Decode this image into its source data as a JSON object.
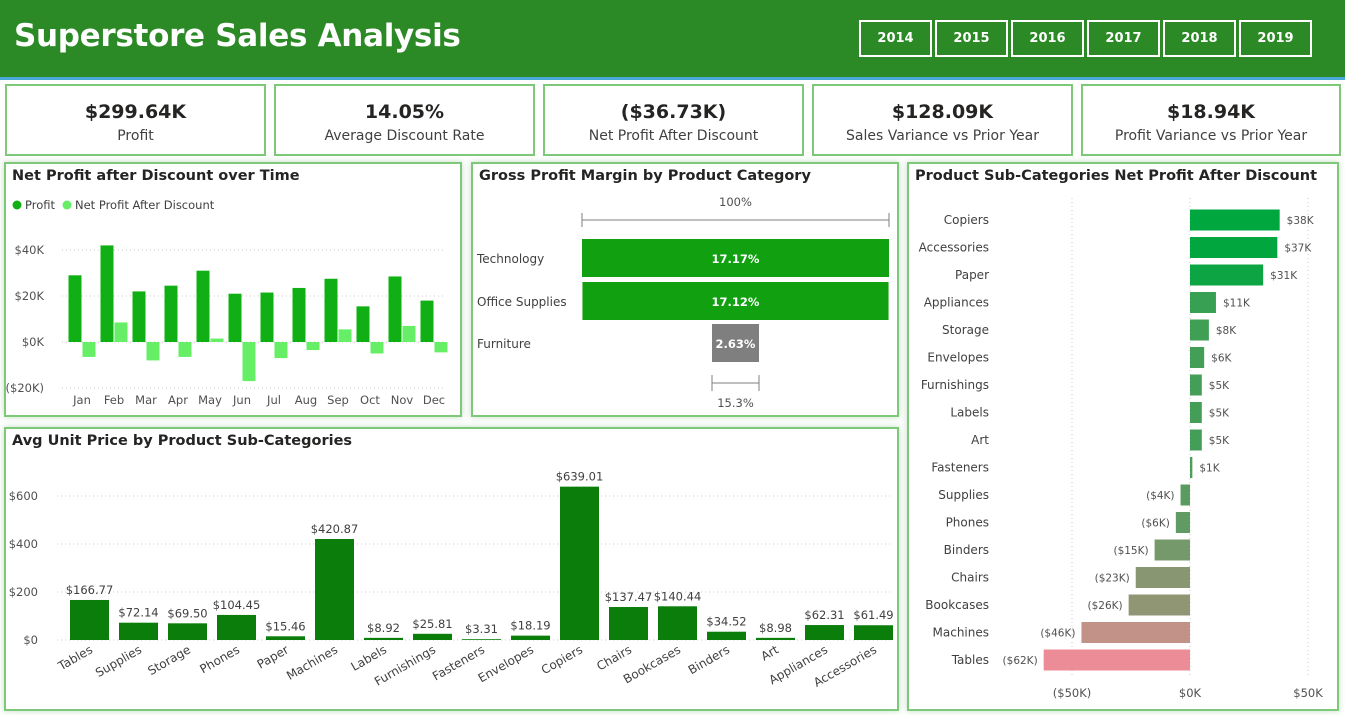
{
  "header": {
    "title": "Superstore Sales Analysis",
    "years": [
      "2014",
      "2015",
      "2016",
      "2017",
      "2018",
      "2019"
    ]
  },
  "kpis": [
    {
      "value": "$299.64K",
      "label": "Profit"
    },
    {
      "value": "14.05%",
      "label": "Average Discount Rate"
    },
    {
      "value": "($36.73K)",
      "label": "Net Profit After Discount"
    },
    {
      "value": "$128.09K",
      "label": "Sales Variance vs Prior Year"
    },
    {
      "value": "$18.94K",
      "label": "Profit Variance vs Prior Year"
    }
  ],
  "colors": {
    "header_green": "#2b8a26",
    "profit": "#10b014",
    "net_profit_after_discount": "#66ee66",
    "funnel_bar": "#10a010",
    "funnel_grey": "#7f7f7f",
    "unit_price_bar": "#0a7d0a"
  },
  "chart_data": [
    {
      "type": "bar",
      "title": "Net Profit after Discount over Time",
      "categories": [
        "Jan",
        "Feb",
        "Mar",
        "Apr",
        "May",
        "Jun",
        "Jul",
        "Aug",
        "Sep",
        "Oct",
        "Nov",
        "Dec"
      ],
      "series": [
        {
          "name": "Profit",
          "values": [
            29000,
            42000,
            22000,
            24500,
            31000,
            21000,
            21500,
            23500,
            27500,
            15500,
            28500,
            18000
          ]
        },
        {
          "name": "Net Profit After Discount",
          "values": [
            -6500,
            8500,
            -8000,
            -6500,
            1500,
            -17000,
            -7000,
            -3500,
            5500,
            -5000,
            7000,
            -4500
          ]
        }
      ],
      "y_ticks": [
        "$40K",
        "$20K",
        "$0K",
        "($20K)"
      ],
      "ylim": [
        -20000,
        45000
      ],
      "legend": "top-left",
      "grid": true
    },
    {
      "type": "bar",
      "title": "Gross Profit Margin by Product Category",
      "categories": [
        "Technology",
        "Office Supplies",
        "Furniture"
      ],
      "values": [
        17.17,
        17.12,
        2.63
      ],
      "labels": [
        "17.17%",
        "17.12%",
        "2.63%"
      ],
      "top_label": "100%",
      "bottom_label": "15.3%"
    },
    {
      "type": "bar",
      "title": "Product Sub-Categories Net Profit After Discount",
      "categories": [
        "Copiers",
        "Accessories",
        "Paper",
        "Appliances",
        "Storage",
        "Envelopes",
        "Furnishings",
        "Labels",
        "Art",
        "Fasteners",
        "Supplies",
        "Phones",
        "Binders",
        "Chairs",
        "Bookcases",
        "Machines",
        "Tables"
      ],
      "values": [
        38000,
        37000,
        31000,
        11000,
        8000,
        6000,
        5000,
        5000,
        5000,
        1000,
        -4000,
        -6000,
        -15000,
        -23000,
        -26000,
        -46000,
        -62000
      ],
      "labels": [
        "$38K",
        "$37K",
        "$31K",
        "$11K",
        "$8K",
        "$6K",
        "$5K",
        "$5K",
        "$5K",
        "$1K",
        "($4K)",
        "($6K)",
        "($15K)",
        "($23K)",
        "($26K)",
        "($46K)",
        "($62K)"
      ],
      "x_ticks": [
        "($50K)",
        "$0K",
        "$50K"
      ],
      "xlim": [
        -62000,
        50000
      ],
      "orientation": "horizontal"
    },
    {
      "type": "bar",
      "title": "Avg Unit Price by Product Sub-Categories",
      "categories": [
        "Tables",
        "Supplies",
        "Storage",
        "Phones",
        "Paper",
        "Machines",
        "Labels",
        "Furnishings",
        "Fasteners",
        "Envelopes",
        "Copiers",
        "Chairs",
        "Bookcases",
        "Binders",
        "Art",
        "Appliances",
        "Accessories"
      ],
      "values": [
        166.77,
        72.14,
        69.5,
        104.45,
        15.46,
        420.87,
        8.92,
        25.81,
        3.31,
        18.19,
        639.01,
        137.47,
        140.44,
        34.52,
        8.98,
        62.31,
        61.49
      ],
      "labels": [
        "$166.77",
        "$72.14",
        "$69.50",
        "$104.45",
        "$15.46",
        "$420.87",
        "$8.92",
        "$25.81",
        "$3.31",
        "$18.19",
        "$639.01",
        "$137.47",
        "$140.44",
        "$34.52",
        "$8.98",
        "$62.31",
        "$61.49"
      ],
      "y_ticks": [
        "$600",
        "$400",
        "$200",
        "$0"
      ],
      "ylim": [
        0,
        660
      ],
      "grid": true
    }
  ]
}
